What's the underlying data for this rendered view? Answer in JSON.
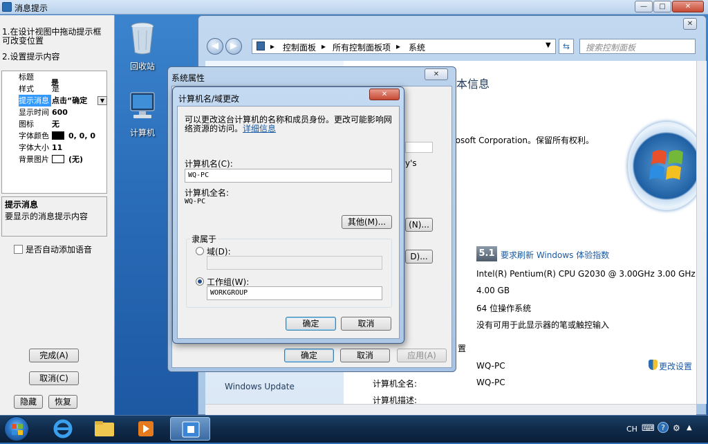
{
  "tool_window": {
    "title": "消息提示",
    "notes": [
      "1.在设计视图中拖动提示框可改变位置",
      "2.设置提示内容"
    ],
    "properties": [
      {
        "key": "标题",
        "value": "是"
      },
      {
        "key": "样式",
        "value": "是"
      },
      {
        "key": "提示消息",
        "value": "点击“确定"
      },
      {
        "key": "显示时间",
        "value": "600"
      },
      {
        "key": "图标",
        "value": "无"
      },
      {
        "key": "字体颜色",
        "value": "0, 0, 0"
      },
      {
        "key": "字体大小",
        "value": "11"
      },
      {
        "key": "背景图片",
        "value": "(无)"
      }
    ],
    "desc_title": "提示消息",
    "desc_text": "要显示的消息提示内容",
    "voice_checkbox": "是否自动添加语音",
    "finish_button": "完成(A)",
    "cancel_button": "取消(C)",
    "hide_button": "隐藏",
    "restore_button": "恢复"
  },
  "desktop": {
    "recycle_bin": "回收站",
    "computer": "计算机"
  },
  "control_panel": {
    "breadcrumb": [
      "控制面板",
      "所有控制面板项",
      "系统"
    ],
    "search_placeholder": "搜索控制面板",
    "heading": "本信息",
    "copyright": "rosoft Corporation。保留所有权利。",
    "rating_score": "5.1",
    "rating_link": "要求刷新 Windows 体验指数",
    "cpu": "Intel(R) Pentium(R) CPU G2030 @ 3.00GHz   3.00 GHz",
    "ram": "4.00 GB",
    "os_type": "64 位操作系统",
    "pen": "没有可用于此显示器的笔或触控输入",
    "section_tail": "置",
    "computer_name": "WQ-PC",
    "full_name_label": "计算机全名:",
    "full_name": "WQ-PC",
    "desc_label": "计算机描述:",
    "change_settings": "更改设置",
    "left_update": "Windows Update",
    "partial_text1": "y's",
    "partial_btn": "(N)...",
    "partial_btn2": "D)..."
  },
  "sys_props": {
    "title": "系统属性",
    "ok": "确定",
    "cancel": "取消",
    "apply": "应用(A)"
  },
  "computer_name_dialog": {
    "title": "计算机名/域更改",
    "intro": "可以更改这台计算机的名称和成员身份。更改可能影响网络资源的访问。",
    "details_link": "详细信息",
    "name_label": "计算机名(C):",
    "name_value": "WQ-PC",
    "full_label": "计算机全名:",
    "full_value": "WQ-PC",
    "other_button": "其他(M)...",
    "member_label": "隶属于",
    "domain_label": "域(D):",
    "workgroup_label": "工作组(W):",
    "workgroup_value": "WORKGROUP",
    "ok": "确定",
    "cancel": "取消"
  },
  "taskbar": {
    "lang": "CH"
  },
  "colors": {
    "accent": "#3399ff",
    "link": "#1a5aa6",
    "heading": "#1e395b"
  }
}
